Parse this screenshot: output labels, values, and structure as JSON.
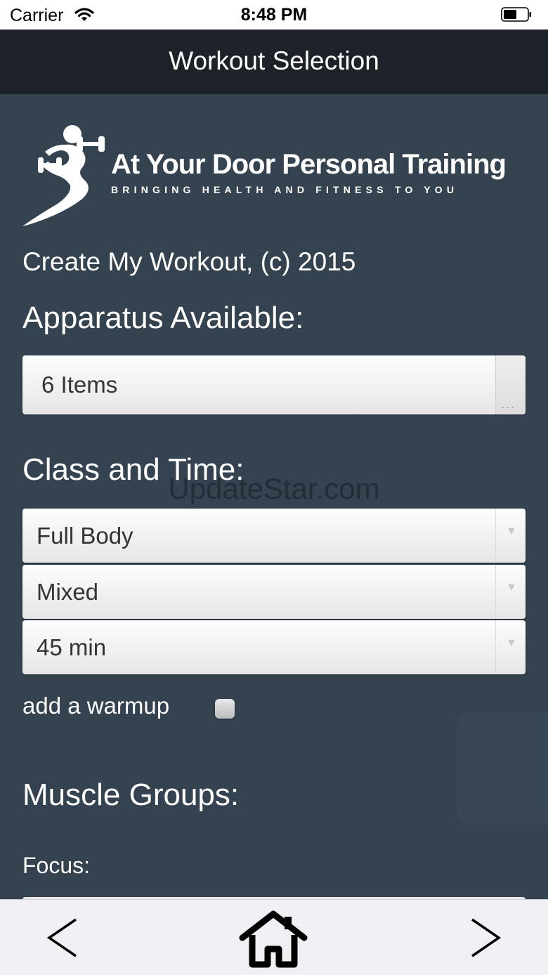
{
  "status_bar": {
    "carrier": "Carrier",
    "time": "8:48 PM",
    "icons": [
      "wifi-icon",
      "battery-icon"
    ]
  },
  "nav": {
    "title": "Workout Selection"
  },
  "brand": {
    "name": "At Your Door Personal Training",
    "tagline": "BRINGING HEALTH AND FITNESS TO YOU",
    "logo_icon": "runner-with-dumbbells-icon"
  },
  "app_subtitle": "Create My Workout, (c) 2015",
  "apparatus": {
    "heading": "Apparatus Available:",
    "value": "6 Items",
    "more_label": "..."
  },
  "class_and_time": {
    "heading": "Class and Time:",
    "class_value": "Full Body",
    "style_value": "Mixed",
    "duration_value": "45 min"
  },
  "warmup": {
    "label": "add a warmup",
    "checked": false
  },
  "muscle_groups": {
    "heading": "Muscle Groups:",
    "focus_label": "Focus:"
  },
  "watermark": "UpdateStar.com",
  "toolbar": {
    "icons": [
      "back-arrow-icon",
      "home-icon",
      "forward-arrow-icon"
    ]
  },
  "colors": {
    "background": "#34434f",
    "nav_bar": "#1c2228",
    "toolbar": "#efeff4"
  }
}
